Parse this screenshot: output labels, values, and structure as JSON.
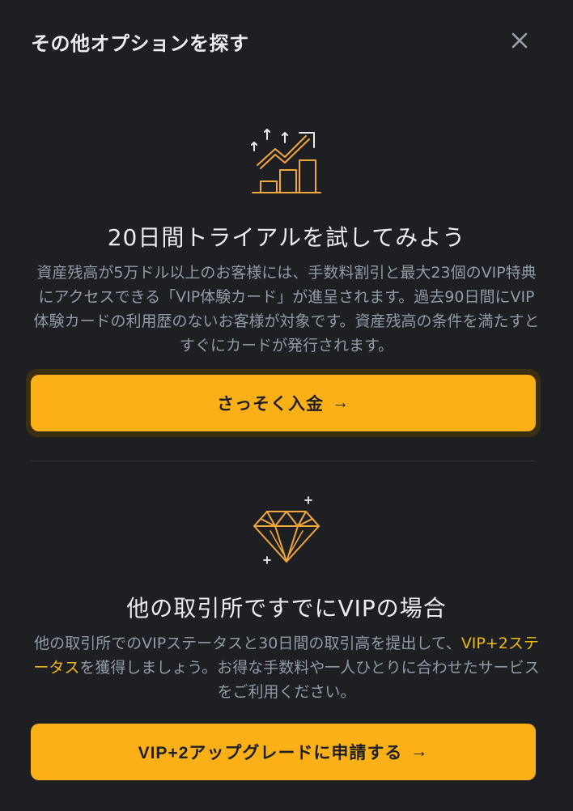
{
  "modal": {
    "title": "その他オプションを探す"
  },
  "trial": {
    "heading": "20日間トライアルを試してみよう",
    "description": "資産残高が5万ドル以上のお客様には、手数料割引と最大23個のVIP特典にアクセスできる「VIP体験カード」が進呈されます。過去90日間にVIP体験カードの利用歴のないお客様が対象です。資産残高の条件を満たすとすぐにカードが発行されます。",
    "button_label": "さっそく入金",
    "button_arrow": "→"
  },
  "vip": {
    "heading": "他の取引所ですでにVIPの場合",
    "description_pre": "他の取引所でのVIPステータスと30日間の取引高を提出して、",
    "description_link": "VIP+2ステータス",
    "description_post": "を獲得しましょう。お得な手数料や一人ひとりに合わせたサービスをご利用ください。",
    "button_label": "VIP+2アップグレードに申請する",
    "button_arrow": "→"
  },
  "colors": {
    "background": "#1e1f23",
    "accent": "#fcb017",
    "text_primary": "#eaecef",
    "text_secondary": "#929aa5",
    "link": "#f0b90b"
  },
  "icons": {
    "close": "close-icon",
    "chart": "growth-chart-icon",
    "diamond": "diamond-icon"
  }
}
